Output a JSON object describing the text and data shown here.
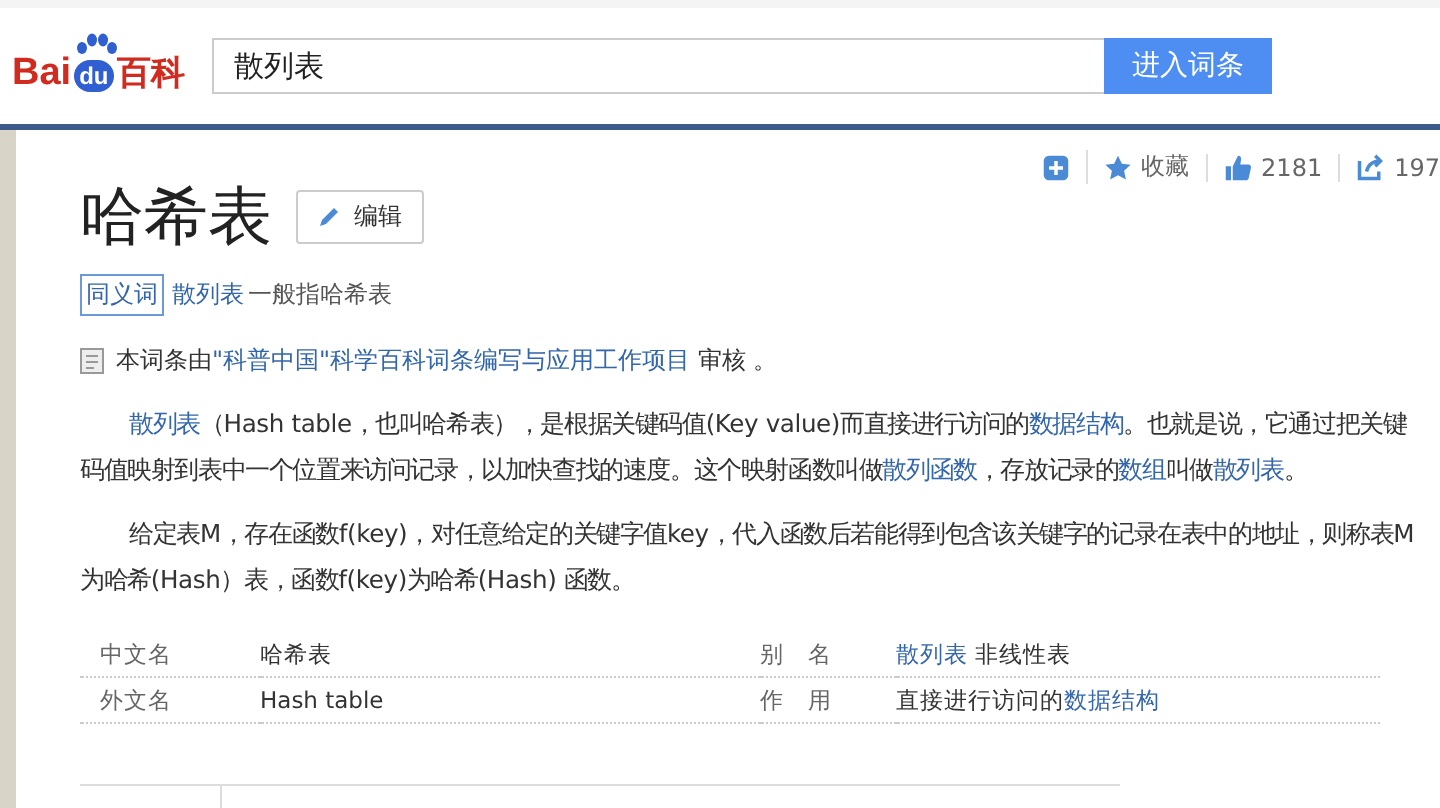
{
  "header": {
    "logo": {
      "left": "Bai",
      "badge": "du",
      "right": "百科"
    },
    "search": {
      "value": "散列表"
    },
    "button": "进入词条"
  },
  "actions": [
    {
      "kind": "plus"
    },
    {
      "kind": "star",
      "label": "收藏"
    },
    {
      "kind": "thumb",
      "label": "2181"
    },
    {
      "kind": "share",
      "label": "197"
    }
  ],
  "title": "哈希表",
  "edit_button": "编辑",
  "synonym": {
    "tag": "同义词",
    "link": "散列表",
    "text": "一般指哈希表"
  },
  "review": [
    {
      "text": "本词条由",
      "link": false
    },
    {
      "text": "\"科普中国\"科学百科词条编写与应用工作项目",
      "link": true
    },
    {
      "text": " 审核 。",
      "link": false
    }
  ],
  "paragraphs": [
    [
      {
        "text": "散列表",
        "link": true
      },
      {
        "text": "（Hash table，也叫哈希表），是根据关键码值(Key value)而直接进行访问的",
        "link": false
      },
      {
        "text": "数据结构",
        "link": true
      },
      {
        "text": "。也就是说，它通过把关键码值映射到表中一个位置来访问记录，以加快查找的速度。这个映射函数叫做",
        "link": false
      },
      {
        "text": "散列函数",
        "link": true
      },
      {
        "text": "，存放记录的",
        "link": false
      },
      {
        "text": "数组",
        "link": true
      },
      {
        "text": "叫做",
        "link": false
      },
      {
        "text": "散列表",
        "link": true
      },
      {
        "text": "。",
        "link": false
      }
    ],
    [
      {
        "text": "给定表M，存在函数f(key)，对任意给定的关键字值key，代入函数后若能得到包含该关键字的记录在表中的地址，则称表M为哈希(Hash）表，函数f(key)为哈希(Hash) 函数。",
        "link": false
      }
    ]
  ],
  "basic_info": [
    {
      "label": "中文名",
      "value": [
        {
          "text": "哈希表",
          "link": false
        }
      ],
      "label_2": "别　名",
      "value_2": [
        {
          "text": "散列表",
          "link": true
        },
        {
          "text": " 非线性表",
          "link": false
        }
      ]
    },
    {
      "label": "外文名",
      "value": [
        {
          "text": "Hash table",
          "link": false
        }
      ],
      "label_2": "作　用",
      "value_2": [
        {
          "text": "直接进行访问的",
          "link": false
        },
        {
          "text": "数据结构",
          "link": true
        }
      ]
    }
  ]
}
